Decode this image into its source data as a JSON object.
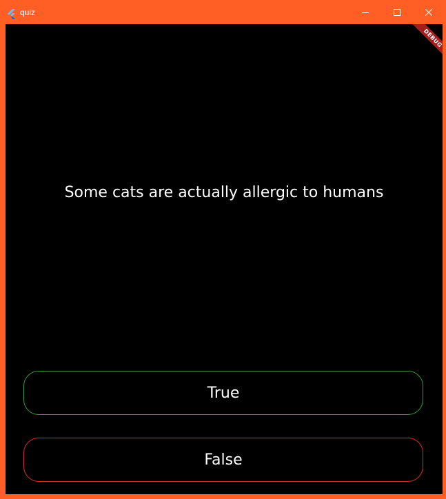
{
  "window": {
    "title": "quiz",
    "accent_color": "#ff5f25",
    "icons": {
      "app": "flutter-logo-icon",
      "minimize": "minimize-icon",
      "maximize": "maximize-icon",
      "close": "close-icon"
    }
  },
  "debug_banner": {
    "label": "DEBUG",
    "color": "#a51e1e"
  },
  "quiz": {
    "question": "Some cats are actually allergic to humans",
    "true_label": "True",
    "false_label": "False",
    "true_color": "#3a9b3f",
    "false_color": "#d9312a"
  }
}
